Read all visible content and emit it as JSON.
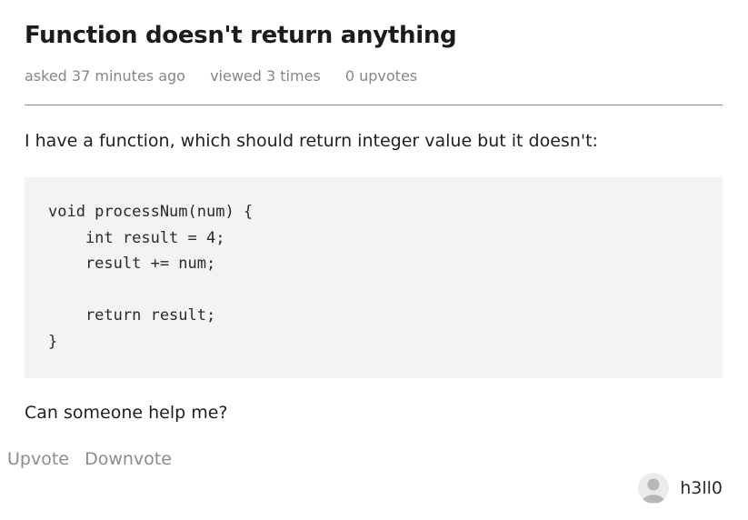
{
  "question": {
    "title": "Function doesn't return anything",
    "meta": {
      "asked": "asked 37 minutes ago",
      "viewed": "viewed 3 times",
      "upvotes": "0 upvotes"
    },
    "intro": "I have a function, which should return integer value but it doesn't:",
    "code_lines": [
      "void processNum(num) {",
      "    int result = 4;",
      "    result += num;",
      "",
      "    return result;",
      "}"
    ],
    "closing": "Can someone help me?"
  },
  "actions": {
    "upvote_label": "Upvote",
    "downvote_label": "Downvote"
  },
  "author": {
    "name": "h3ll0",
    "avatar_icon": "user-avatar-icon"
  }
}
